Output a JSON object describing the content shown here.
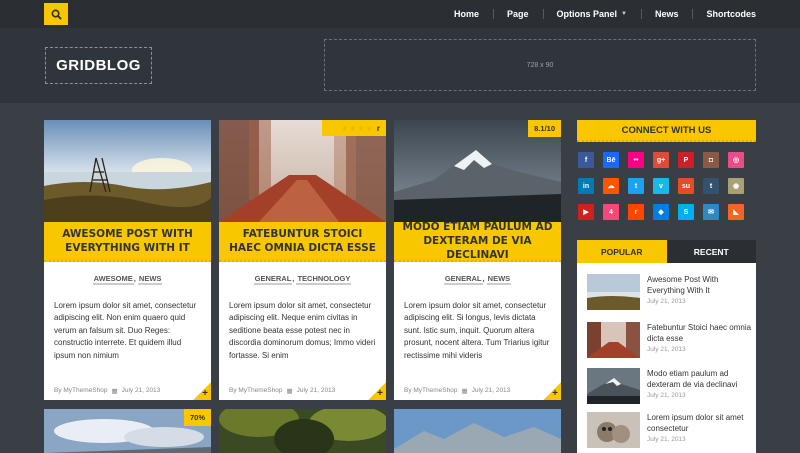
{
  "nav": {
    "items": [
      "Home",
      "Page",
      "Options Panel",
      "News",
      "Shortcodes"
    ]
  },
  "header": {
    "logo": "GRIDBLOG",
    "ad": "728 x 90"
  },
  "cards": [
    {
      "title": "AWESOME POST WITH EVERYTHING WITH IT",
      "tags": [
        "AWESOME",
        "NEWS"
      ],
      "excerpt": "Lorem ipsum dolor sit amet, consectetur adipiscing elit. Non enim quaero quid verum an falsum sit. Duo Reges: constructio interrete. Et quidem illud ipsum non nimium",
      "author": "By MyThemeShop",
      "date": "July 21, 2013"
    },
    {
      "title": "FATEBUNTUR STOICI HAEC OMNIA DICTA ESSE",
      "tags": [
        "GENERAL",
        "TECHNOLOGY"
      ],
      "excerpt": "Lorem ipsum dolor sit amet, consectetur adipiscing elit. Neque enim civitas in seditione beata esse potest nec in discordia dominorum domus; Immo videri fortasse. Si enim",
      "author": "By MyThemeShop",
      "date": "July 21, 2013",
      "rating_label": "r"
    },
    {
      "title": "MODO ETIAM PAULUM AD DEXTERAM DE VIA DECLINAVI",
      "tags": [
        "GENERAL",
        "NEWS"
      ],
      "excerpt": "Lorem ipsum dolor sit amet, consectetur adipiscing elit. Si longus, levis dictata sunt. Istic sum, inquit. Quorum altera prosunt, nocent altera. Tum Triarius igitur rectissime mihi videris",
      "author": "By MyThemeShop",
      "date": "July 21, 2013",
      "badge": "8.1/10"
    }
  ],
  "row2": {
    "badge": "70%"
  },
  "sidebar": {
    "connect_title": "CONNECT WITH US",
    "social": [
      {
        "icon": "facebook-icon",
        "glyph": "f",
        "color": "#3b5998"
      },
      {
        "icon": "behance-icon",
        "glyph": "Bē",
        "color": "#1769ff"
      },
      {
        "icon": "flickr-icon",
        "glyph": "••",
        "color": "#ff0084"
      },
      {
        "icon": "googleplus-icon",
        "glyph": "g+",
        "color": "#dd4b39"
      },
      {
        "icon": "pinterest-icon",
        "glyph": "P",
        "color": "#cb2027"
      },
      {
        "icon": "instagram-icon",
        "glyph": "◘",
        "color": "#8a5a44"
      },
      {
        "icon": "dribbble-icon",
        "glyph": "◎",
        "color": "#ea4c89"
      },
      {
        "icon": "linkedin-icon",
        "glyph": "in",
        "color": "#007bb6"
      },
      {
        "icon": "soundcloud-icon",
        "glyph": "☁",
        "color": "#ff5500"
      },
      {
        "icon": "twitter-icon",
        "glyph": "t",
        "color": "#1da1f2"
      },
      {
        "icon": "vimeo-icon",
        "glyph": "v",
        "color": "#1ab7ea"
      },
      {
        "icon": "stumbleupon-icon",
        "glyph": "su",
        "color": "#eb4924"
      },
      {
        "icon": "tumblr-icon",
        "glyph": "t",
        "color": "#34526f"
      },
      {
        "icon": "github-icon",
        "glyph": "◉",
        "color": "#a9a176"
      },
      {
        "icon": "youtube-icon",
        "glyph": "▶",
        "color": "#cd201f"
      },
      {
        "icon": "foursquare-icon",
        "glyph": "4",
        "color": "#f94877"
      },
      {
        "icon": "reddit-icon",
        "glyph": "r",
        "color": "#ff4500"
      },
      {
        "icon": "dropbox-icon",
        "glyph": "◆",
        "color": "#007ee5"
      },
      {
        "icon": "skype-icon",
        "glyph": "S",
        "color": "#00aff0"
      },
      {
        "icon": "email-icon",
        "glyph": "✉",
        "color": "#2d88c4"
      },
      {
        "icon": "rss-icon",
        "glyph": "◣",
        "color": "#f26522"
      }
    ],
    "tabs": [
      "POPULAR",
      "RECENT"
    ],
    "posts": [
      {
        "title": "Awesome Post With Everything With It",
        "date": "July 21, 2013"
      },
      {
        "title": "Fatebuntur Stoici haec omnia dicta esse",
        "date": "July 21, 2013"
      },
      {
        "title": "Modo etiam paulum ad dexteram de via declinavi",
        "date": "July 21, 2013"
      },
      {
        "title": "Lorem ipsum dolor sit amet consectetur",
        "date": "July 21, 2013"
      }
    ]
  }
}
